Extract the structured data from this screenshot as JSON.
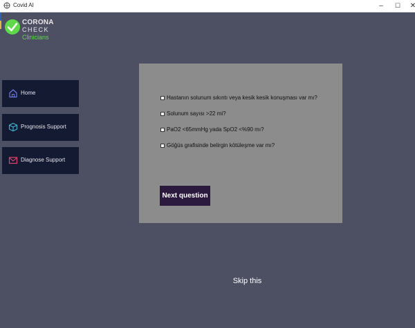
{
  "window": {
    "title": "Covid AI",
    "controls": {
      "minimize": "–",
      "maximize": "☐",
      "close": "✕"
    }
  },
  "logo": {
    "word1": "CORONA",
    "word2": "CHECK",
    "word3": "Clinicians",
    "accent_color": "#5fd94a"
  },
  "sidebar": {
    "items": [
      {
        "label": "Home",
        "icon": "home-icon",
        "icon_color": "#6f7ae0"
      },
      {
        "label": "Prognosis Support",
        "icon": "cube-icon",
        "icon_color": "#3fb6d6"
      },
      {
        "label": "Diagnose Support",
        "icon": "mail-icon",
        "icon_color": "#e0446e"
      }
    ]
  },
  "question": {
    "options": [
      {
        "label": "Hastanın solunum sıkıntı veya kesik kesik konuşması var mı?",
        "checked": false
      },
      {
        "label": "Solunum sayısı >22 mi?",
        "checked": false
      },
      {
        "label": "PaO2 <65mmHg yada SpO2 <%90 mı?",
        "checked": false
      },
      {
        "label": "Göğüs grafisinde belirgin kötüleşme var mı?",
        "checked": false
      }
    ],
    "next_label": "Next question"
  },
  "skip_label": "Skip this",
  "colors": {
    "background": "#4d4f63",
    "panel": "#8c8c8c",
    "nav": "#141a32",
    "button": "#2b1a3d"
  }
}
